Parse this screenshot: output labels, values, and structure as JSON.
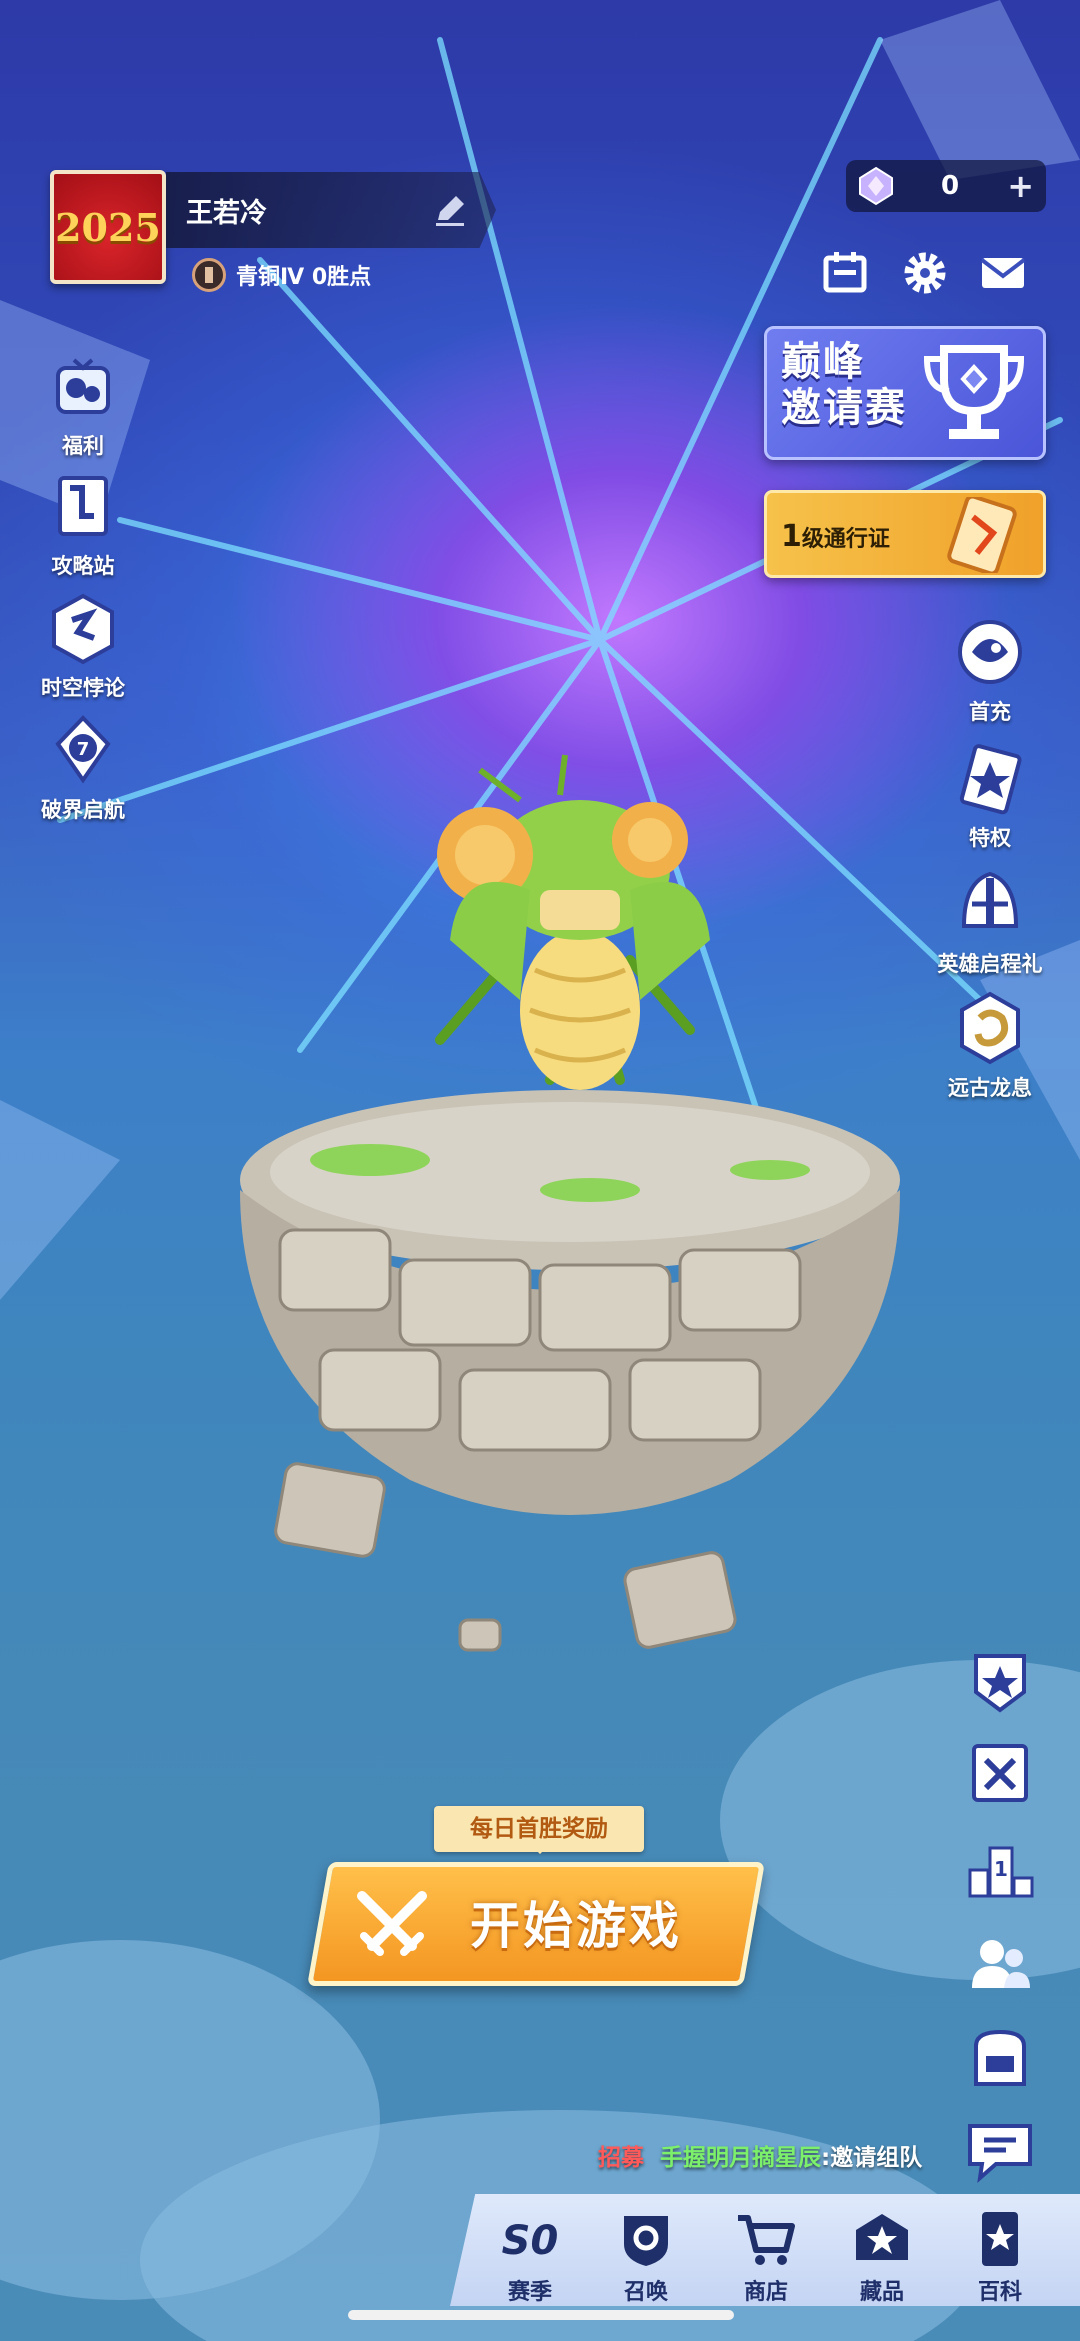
{
  "profile": {
    "avatar_text": "2025",
    "name": "王若冷",
    "rank": "青铜Ⅳ  0胜点"
  },
  "currency": {
    "gems": "0",
    "plus": "+"
  },
  "left_menu": [
    {
      "label": "福利",
      "icon": "gift-chat-icon"
    },
    {
      "label": "攻略站",
      "icon": "guide-book-icon"
    },
    {
      "label": "时空悖论",
      "icon": "paradox-icon"
    },
    {
      "label": "破界启航",
      "icon": "voyage-icon"
    }
  ],
  "banners": {
    "tournament_line1": "巅峰",
    "tournament_line2": "邀请赛",
    "pass_level": "1",
    "pass_label": "级通行证"
  },
  "right_menu": [
    {
      "label": "首充",
      "icon": "first-recharge-icon"
    },
    {
      "label": "特权",
      "icon": "privilege-card-icon"
    },
    {
      "label": "英雄启程礼",
      "icon": "hero-helmet-icon"
    },
    {
      "label": "远古龙息",
      "icon": "dragon-breath-icon"
    }
  ],
  "start": {
    "first_win": "每日首胜奖励",
    "button": "开始游戏"
  },
  "recruit": {
    "tag": "招募",
    "text": "手握明月摘星辰",
    "suffix": ":邀请组队"
  },
  "bottom_nav": [
    {
      "label": "赛季",
      "badge": "S0"
    },
    {
      "label": "召唤"
    },
    {
      "label": "商店"
    },
    {
      "label": "藏品"
    },
    {
      "label": "百科"
    }
  ],
  "colors": {
    "accent_orange": "#f49622",
    "recruit_red": "#ff5a5a",
    "recruit_green": "#7cf06a",
    "nav_text": "#1f2f6a"
  }
}
